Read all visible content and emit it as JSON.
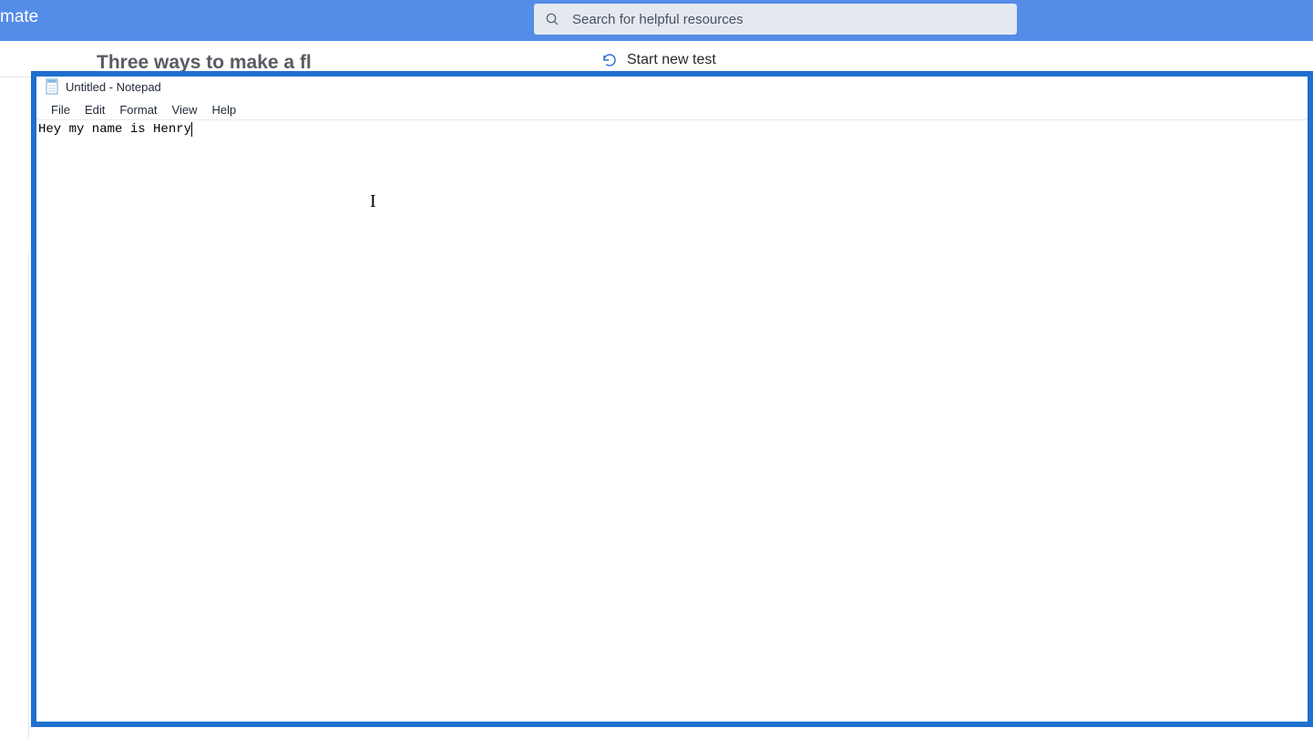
{
  "topbar": {
    "app_name_fragment": "mate",
    "search_placeholder": "Search for helpful resources"
  },
  "subbar": {
    "article_title": "Three ways to make a fl",
    "start_new_test_label": "Start new test"
  },
  "notepad": {
    "window_title": "Untitled - Notepad",
    "menu": {
      "file": "File",
      "edit": "Edit",
      "format": "Format",
      "view": "View",
      "help": "Help"
    },
    "editor_content": "Hey my name is Henry"
  }
}
